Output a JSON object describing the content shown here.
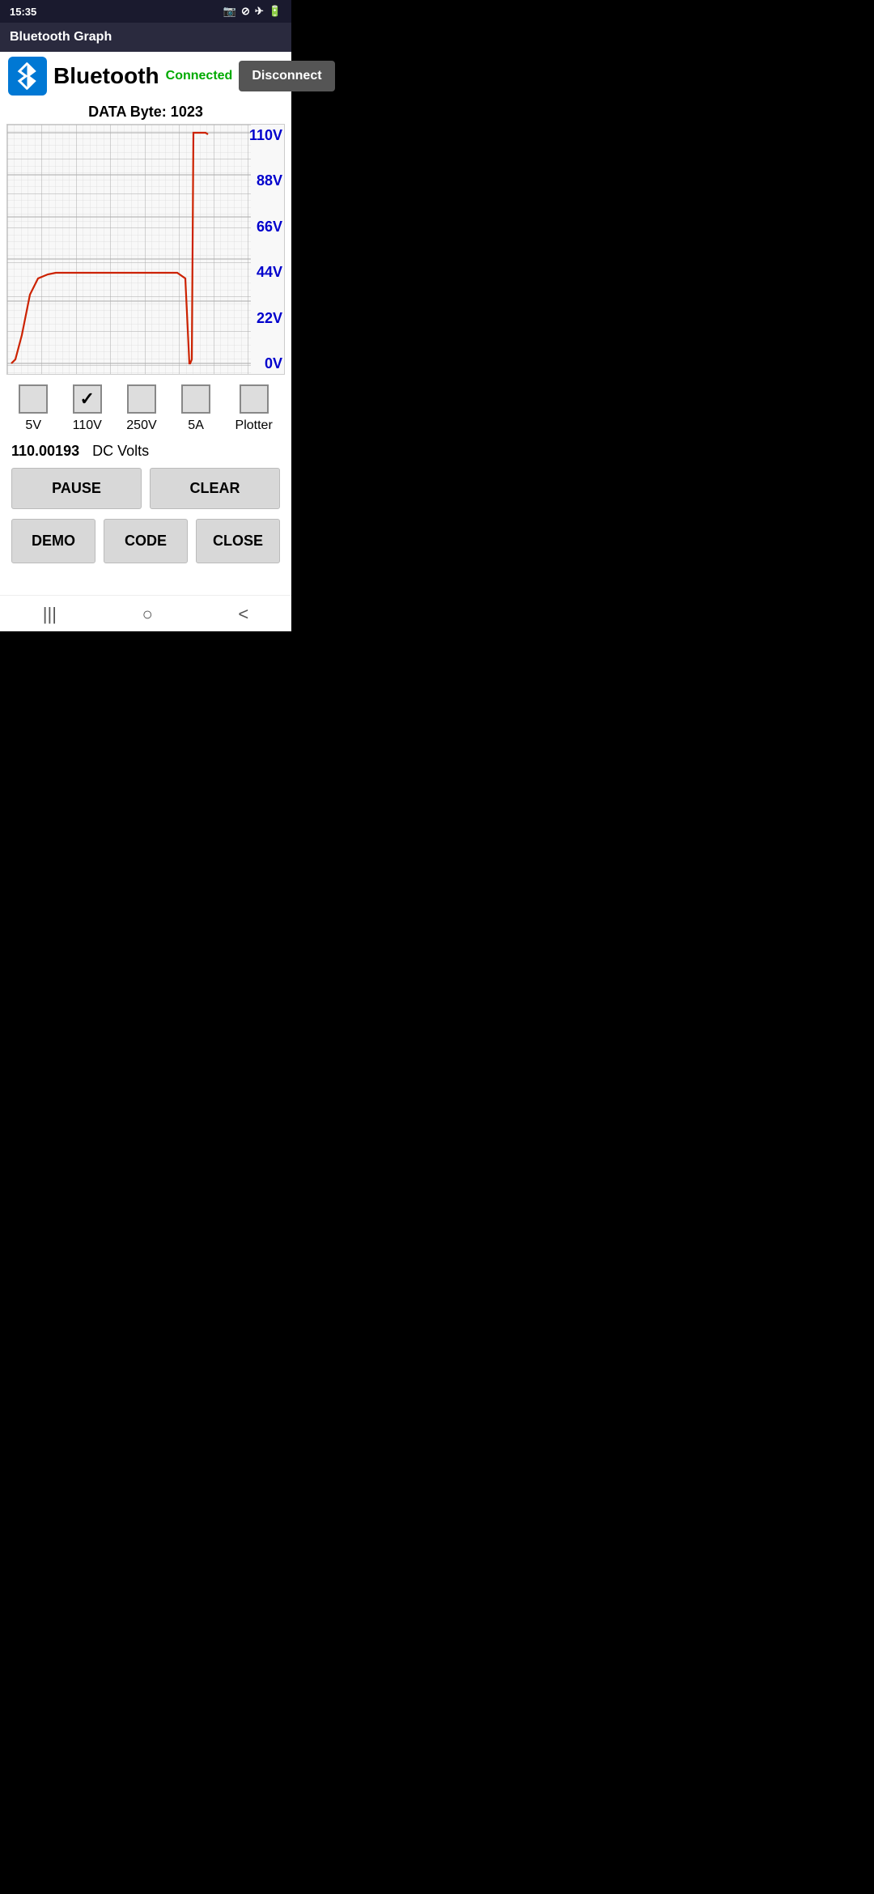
{
  "statusBar": {
    "time": "15:35",
    "icons": [
      "camera-icon",
      "do-not-disturb-icon",
      "airplane-icon",
      "battery-icon"
    ]
  },
  "titleBar": {
    "title": "Bluetooth Graph"
  },
  "header": {
    "bluetoothLabel": "Bluetooth",
    "connectedLabel": "Connected",
    "disconnectLabel": "Disconnect"
  },
  "graph": {
    "dataByteLabel": "DATA Byte: 1023",
    "yLabels": [
      "110V",
      "88V",
      "66V",
      "44V",
      "22V",
      "0V"
    ]
  },
  "checkboxes": [
    {
      "label": "5V",
      "checked": false
    },
    {
      "label": "110V",
      "checked": true
    },
    {
      "label": "250V",
      "checked": false
    },
    {
      "label": "5A",
      "checked": false
    },
    {
      "label": "Plotter",
      "checked": false
    }
  ],
  "valueDisplay": {
    "value": "110.00193",
    "unit": "DC Volts"
  },
  "buttons": {
    "pause": "PAUSE",
    "clear": "CLEAR",
    "demo": "DEMO",
    "code": "CODE",
    "close": "CLOSE"
  },
  "navBar": {
    "menu": "|||",
    "home": "○",
    "back": "<"
  }
}
